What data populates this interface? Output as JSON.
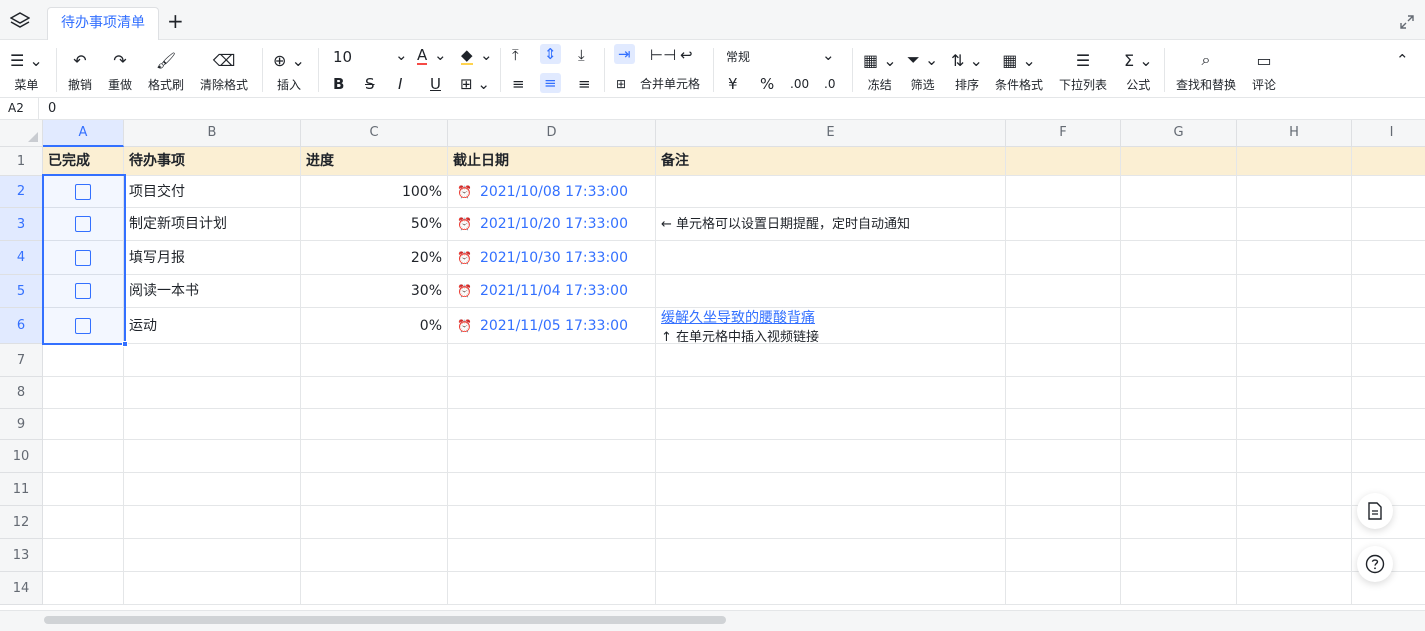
{
  "tab": {
    "title": "待办事项清单",
    "add": "+"
  },
  "toolbar": {
    "menu": "菜单",
    "undo": "撤销",
    "redo": "重做",
    "format_painter": "格式刷",
    "clear_format": "清除格式",
    "insert": "插入",
    "font_size": "10",
    "merge": "合并单元格",
    "number_format": "常规",
    "freeze": "冻结",
    "filter": "筛选",
    "sort": "排序",
    "cond_format": "条件格式",
    "dropdown_list": "下拉列表",
    "formula": "公式",
    "find_replace": "查找和替换",
    "comment": "评论",
    "bold": "B",
    "strike": "S",
    "italic": "I",
    "underline": "U",
    "yen": "¥",
    "percent": "%",
    "dec_inc": ".00",
    "dec_dec": ".0",
    "font_color": "A"
  },
  "formula_bar": {
    "ref": "A2",
    "value": "0"
  },
  "columns": [
    "A",
    "B",
    "C",
    "D",
    "E",
    "F",
    "G",
    "H",
    "I"
  ],
  "rows": [
    "1",
    "2",
    "3",
    "4",
    "5",
    "6",
    "7",
    "8",
    "9",
    "10",
    "11",
    "12",
    "13",
    "14"
  ],
  "sheet": {
    "headers": [
      "已完成",
      "待办事项",
      "进度",
      "截止日期",
      "备注"
    ],
    "tasks": [
      {
        "name": "项目交付",
        "progress": "100%",
        "due": "2021/10/08 17:33:00",
        "note": ""
      },
      {
        "name": "制定新项目计划",
        "progress": "50%",
        "due": "2021/10/20 17:33:00",
        "note": "← 单元格可以设置日期提醒，定时自动通知"
      },
      {
        "name": "填写月报",
        "progress": "20%",
        "due": "2021/10/30 17:33:00",
        "note": ""
      },
      {
        "name": "阅读一本书",
        "progress": "30%",
        "due": "2021/11/04 17:33:00",
        "note": ""
      },
      {
        "name": "运动",
        "progress": "0%",
        "due": "2021/11/05 17:33:00",
        "note_link": "缓解久坐导致的腰酸背痛",
        "note": "↑ 在单元格中插入视频链接"
      }
    ]
  }
}
